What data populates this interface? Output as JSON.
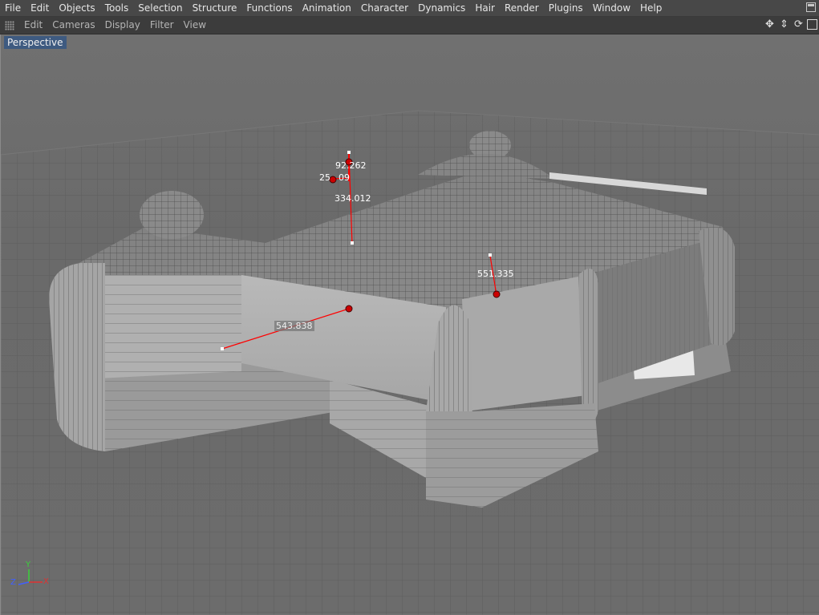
{
  "menu": {
    "items": [
      "File",
      "Edit",
      "Objects",
      "Tools",
      "Selection",
      "Structure",
      "Functions",
      "Animation",
      "Character",
      "Dynamics",
      "Hair",
      "Render",
      "Plugins",
      "Window",
      "Help"
    ]
  },
  "viewport_menu": {
    "items": [
      "Edit",
      "Cameras",
      "Display",
      "Filter",
      "View"
    ]
  },
  "nav_icons": [
    "move-view-icon",
    "dolly-view-icon",
    "rotate-view-icon",
    "maximize-view-icon"
  ],
  "viewport": {
    "label": "Perspective"
  },
  "measurements": {
    "m1": "92.262",
    "m2": "25",
    "m2_tail": "09",
    "m3": "334.012",
    "m4": "551.335",
    "m5": "543.838"
  },
  "axis": {
    "x": "X",
    "y": "Y",
    "z": "Z"
  },
  "colors": {
    "grid": "#5e5e5e",
    "model": "#b5b5b5",
    "measure_line": "#ff0000",
    "selection_accent": "#3e5a80"
  }
}
